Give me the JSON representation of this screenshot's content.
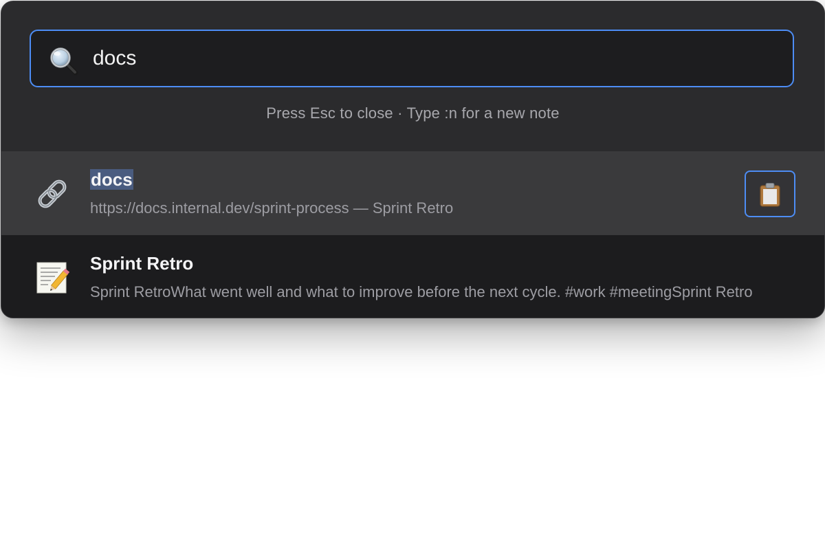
{
  "search": {
    "value": "docs",
    "icon": "magnifying-glass-icon"
  },
  "hint": "Press Esc to close · Type :n for a new note",
  "colors": {
    "accent": "#4d8df5",
    "panel": "#2b2b2d",
    "selected_row": "#3a3a3c",
    "highlight": "#4a5c80"
  },
  "results": [
    {
      "kind": "link",
      "icon": "link-icon",
      "title_match": "docs",
      "subtitle": "https://docs.internal.dev/sprint-process — Sprint Retro",
      "action_icon": "clipboard-icon",
      "selected": true
    },
    {
      "kind": "note",
      "icon": "memo-pencil-icon",
      "title": "Sprint Retro",
      "subtitle": "Sprint RetroWhat went well and what to improve before the next cycle. #work #meetingSprint Retro",
      "selected": false
    }
  ]
}
